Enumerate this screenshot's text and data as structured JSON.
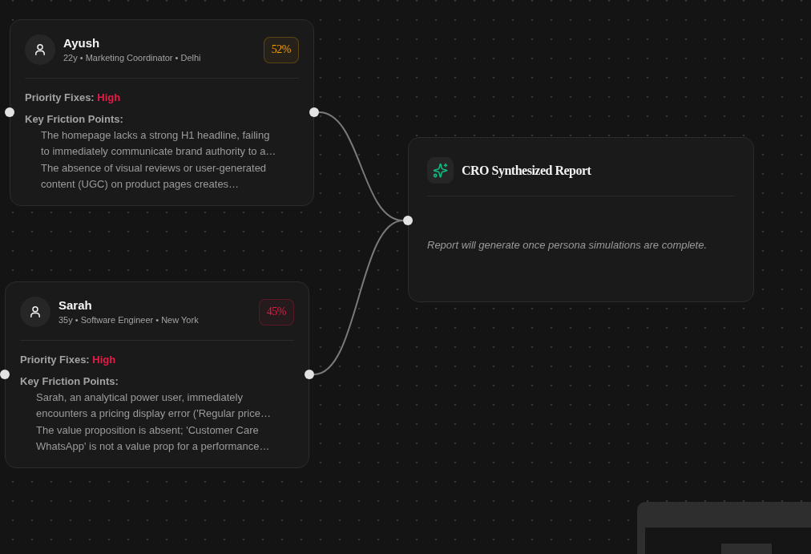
{
  "personas": [
    {
      "name": "Ayush",
      "details": "22y • Marketing Coordinator • Delhi",
      "score": "52%",
      "color": "#f59e0b",
      "priority_label": "Priority Fixes:",
      "priority": "High",
      "friction_label": "Key Friction Points:",
      "friction_points": [
        "The homepage lacks a strong H1 headline, failing to immediately communicate brand authority to a…",
        "The absence of visual reviews or user-generated content (UGC) on product pages creates…"
      ]
    },
    {
      "name": "Sarah",
      "details": "35y • Software Engineer • New York",
      "score": "45%",
      "color": "#e11d48",
      "priority_label": "Priority Fixes:",
      "priority": "High",
      "friction_label": "Key Friction Points:",
      "friction_points": [
        "Sarah, an analytical power user, immediately encounters a pricing display error ('Regular price…",
        "The value proposition is absent; 'Customer Care WhatsApp' is not a value prop for a performance…"
      ]
    }
  ],
  "report": {
    "title": "CRO Synthesized Report",
    "message": "Report will generate once persona simulations are complete."
  }
}
